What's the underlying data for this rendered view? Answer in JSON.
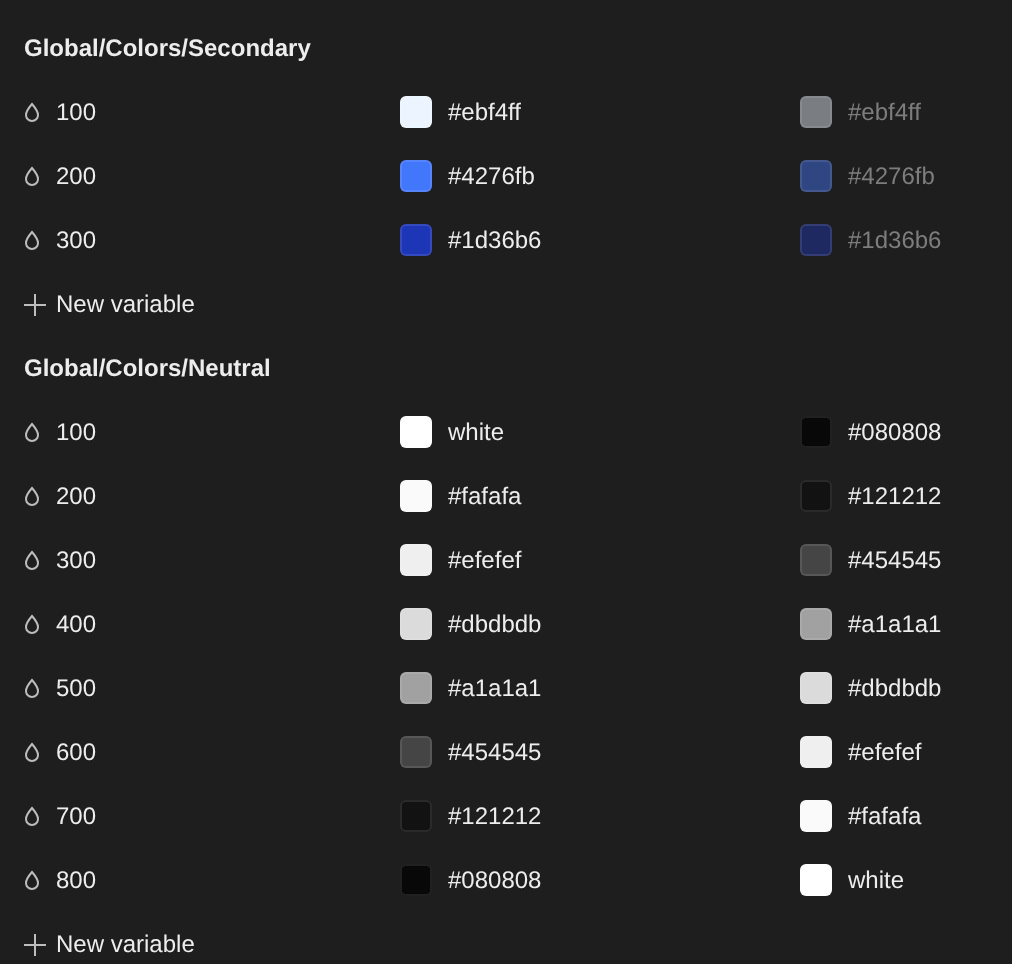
{
  "groups": [
    {
      "title": "Global/Colors/Secondary",
      "variables": [
        {
          "name": "100",
          "values": [
            {
              "text": "#ebf4ff",
              "color": "#ebf4ff",
              "disabled": false
            },
            {
              "text": "#ebf4ff",
              "color": "#7a7e83",
              "disabled": true
            }
          ]
        },
        {
          "name": "200",
          "values": [
            {
              "text": "#4276fb",
              "color": "#4276fb",
              "disabled": false
            },
            {
              "text": "#4276fb",
              "color": "#2e4681",
              "disabled": true
            }
          ]
        },
        {
          "name": "300",
          "values": [
            {
              "text": "#1d36b6",
              "color": "#1d36b6",
              "disabled": false
            },
            {
              "text": "#1d36b6",
              "color": "#1e2962",
              "disabled": true
            }
          ]
        }
      ],
      "add_label": "New variable"
    },
    {
      "title": "Global/Colors/Neutral",
      "variables": [
        {
          "name": "100",
          "values": [
            {
              "text": "white",
              "color": "#ffffff",
              "disabled": false
            },
            {
              "text": "#080808",
              "color": "#080808",
              "disabled": false
            }
          ]
        },
        {
          "name": "200",
          "values": [
            {
              "text": "#fafafa",
              "color": "#fafafa",
              "disabled": false
            },
            {
              "text": "#121212",
              "color": "#121212",
              "disabled": false
            }
          ]
        },
        {
          "name": "300",
          "values": [
            {
              "text": "#efefef",
              "color": "#efefef",
              "disabled": false
            },
            {
              "text": "#454545",
              "color": "#454545",
              "disabled": false
            }
          ]
        },
        {
          "name": "400",
          "values": [
            {
              "text": "#dbdbdb",
              "color": "#dbdbdb",
              "disabled": false
            },
            {
              "text": "#a1a1a1",
              "color": "#a1a1a1",
              "disabled": false
            }
          ]
        },
        {
          "name": "500",
          "values": [
            {
              "text": "#a1a1a1",
              "color": "#a1a1a1",
              "disabled": false
            },
            {
              "text": "#dbdbdb",
              "color": "#dbdbdb",
              "disabled": false
            }
          ]
        },
        {
          "name": "600",
          "values": [
            {
              "text": "#454545",
              "color": "#454545",
              "disabled": false
            },
            {
              "text": "#efefef",
              "color": "#efefef",
              "disabled": false
            }
          ]
        },
        {
          "name": "700",
          "values": [
            {
              "text": "#121212",
              "color": "#121212",
              "disabled": false
            },
            {
              "text": "#fafafa",
              "color": "#fafafa",
              "disabled": false
            }
          ]
        },
        {
          "name": "800",
          "values": [
            {
              "text": "#080808",
              "color": "#080808",
              "disabled": false
            },
            {
              "text": "white",
              "color": "#ffffff",
              "disabled": false
            }
          ]
        }
      ],
      "add_label": "New variable"
    }
  ]
}
